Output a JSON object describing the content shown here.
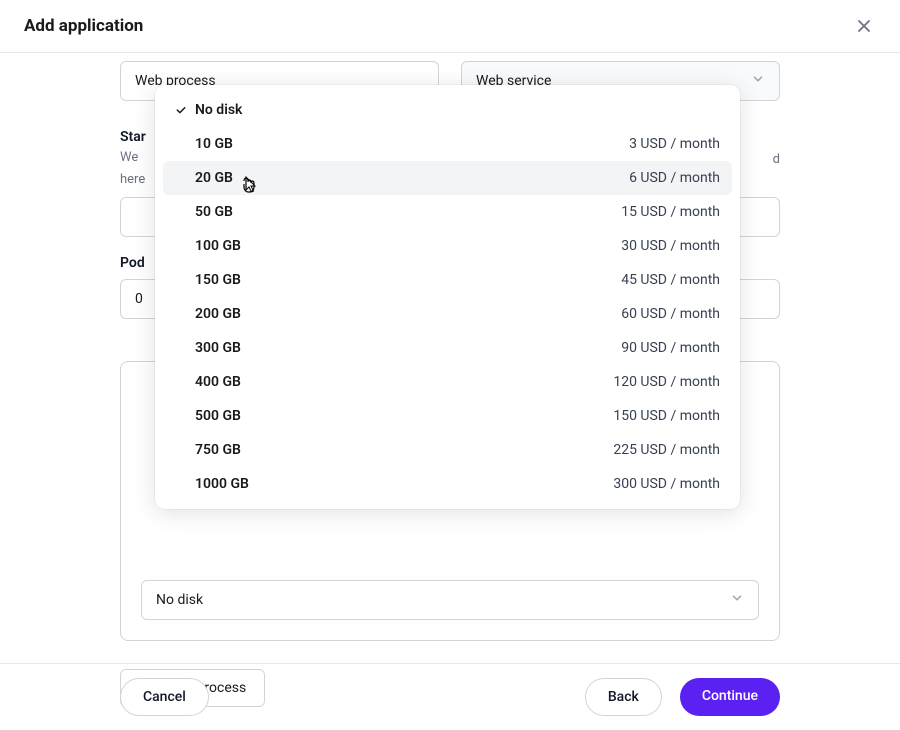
{
  "header": {
    "title": "Add application"
  },
  "topRow": {
    "process": "Web process",
    "service": "Web service"
  },
  "startLabel": {
    "title": "Star",
    "subLine1": "We",
    "subLine2": "here",
    "subLineRight": "d"
  },
  "pod": {
    "label": "Pod",
    "value": "0"
  },
  "diskSelect": {
    "value": "No disk"
  },
  "addProcess": "Add new process",
  "footer": {
    "cancel": "Cancel",
    "back": "Back",
    "continue": "Continue"
  },
  "dropdown": {
    "selected": "No disk",
    "items": [
      {
        "label": "No disk",
        "price": ""
      },
      {
        "label": "10 GB",
        "price": "3 USD / month"
      },
      {
        "label": "20 GB",
        "price": "6 USD / month"
      },
      {
        "label": "50 GB",
        "price": "15 USD / month"
      },
      {
        "label": "100 GB",
        "price": "30 USD / month"
      },
      {
        "label": "150 GB",
        "price": "45 USD / month"
      },
      {
        "label": "200 GB",
        "price": "60 USD / month"
      },
      {
        "label": "300 GB",
        "price": "90 USD / month"
      },
      {
        "label": "400 GB",
        "price": "120 USD / month"
      },
      {
        "label": "500 GB",
        "price": "150 USD / month"
      },
      {
        "label": "750 GB",
        "price": "225 USD / month"
      },
      {
        "label": "1000 GB",
        "price": "300 USD / month"
      }
    ],
    "hoveredIndex": 2
  }
}
